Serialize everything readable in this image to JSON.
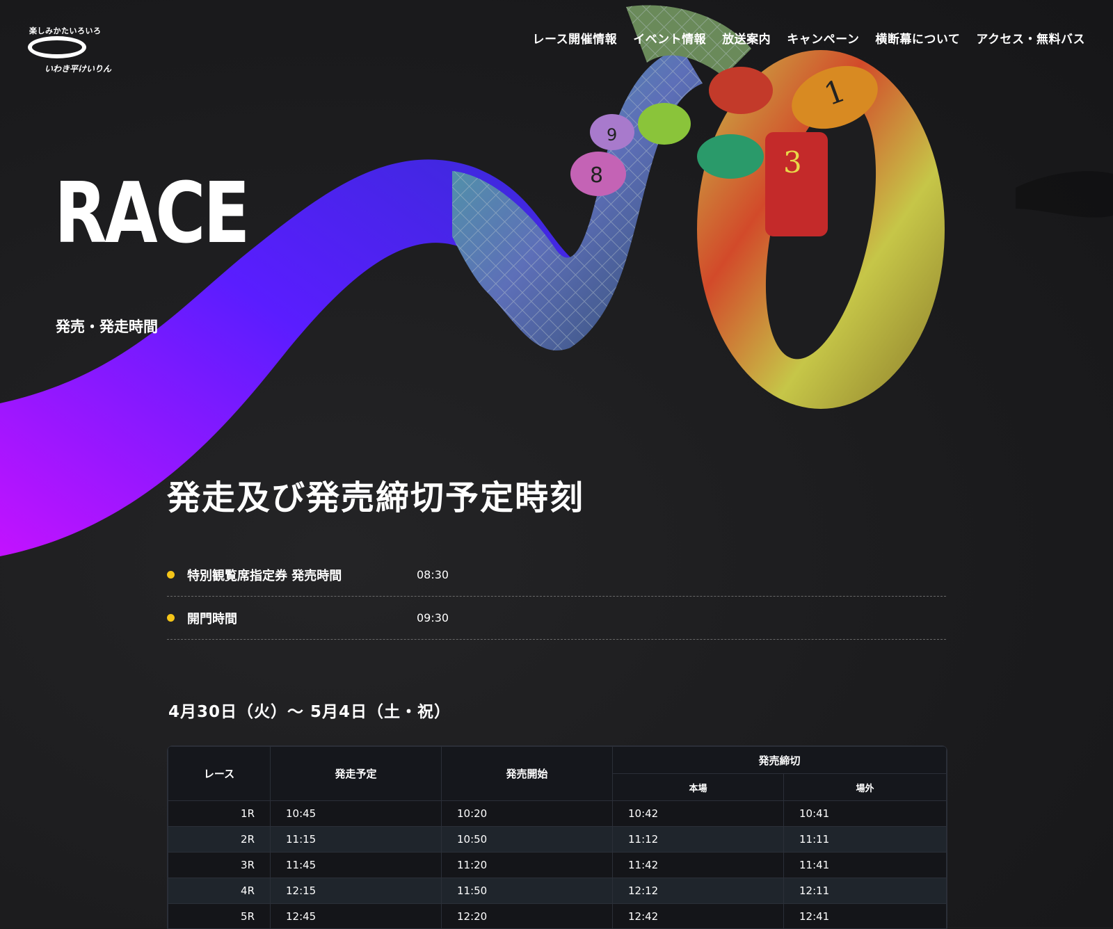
{
  "brand": {
    "tagline": "楽しみかたいろいろ",
    "name": "いわき平けいりん"
  },
  "nav": [
    {
      "label": "レース開催情報"
    },
    {
      "label": "イベント情報"
    },
    {
      "label": "放送案内"
    },
    {
      "label": "キャンペーン"
    },
    {
      "label": "横断幕について"
    },
    {
      "label": "アクセス・無料バス"
    }
  ],
  "hero": {
    "title": "RACE",
    "subtitle": "発売・発走時間"
  },
  "section": {
    "title": "発走及び発売締切予定時刻"
  },
  "info": [
    {
      "label": "特別観覧席指定券 発売時間",
      "time": "08:30"
    },
    {
      "label": "開門時間",
      "time": "09:30"
    }
  ],
  "date_range": "4月30日（火）～ 5月4日（土・祝）",
  "table": {
    "headers": {
      "race": "レース",
      "start": "発走予定",
      "sale_open": "発売開始",
      "sale_close": "発売締切",
      "main": "本場",
      "off": "場外"
    },
    "rows": [
      {
        "race": "1R",
        "start": "10:45",
        "open": "10:20",
        "main": "10:42",
        "off": "10:41"
      },
      {
        "race": "2R",
        "start": "11:15",
        "open": "10:50",
        "main": "11:12",
        "off": "11:11"
      },
      {
        "race": "3R",
        "start": "11:45",
        "open": "11:20",
        "main": "11:42",
        "off": "11:41"
      },
      {
        "race": "4R",
        "start": "12:15",
        "open": "11:50",
        "main": "12:12",
        "off": "12:11"
      },
      {
        "race": "5R",
        "start": "12:45",
        "open": "12:20",
        "main": "12:42",
        "off": "12:41"
      }
    ]
  },
  "colors": {
    "bullet": "#f5c518",
    "ribbon_start": "#c312ff",
    "ribbon_end": "#4d1bff"
  },
  "hero_image": {
    "icon": "cyclists-photo-icon",
    "visible_numbers": [
      "1",
      "3",
      "8",
      "9"
    ]
  }
}
